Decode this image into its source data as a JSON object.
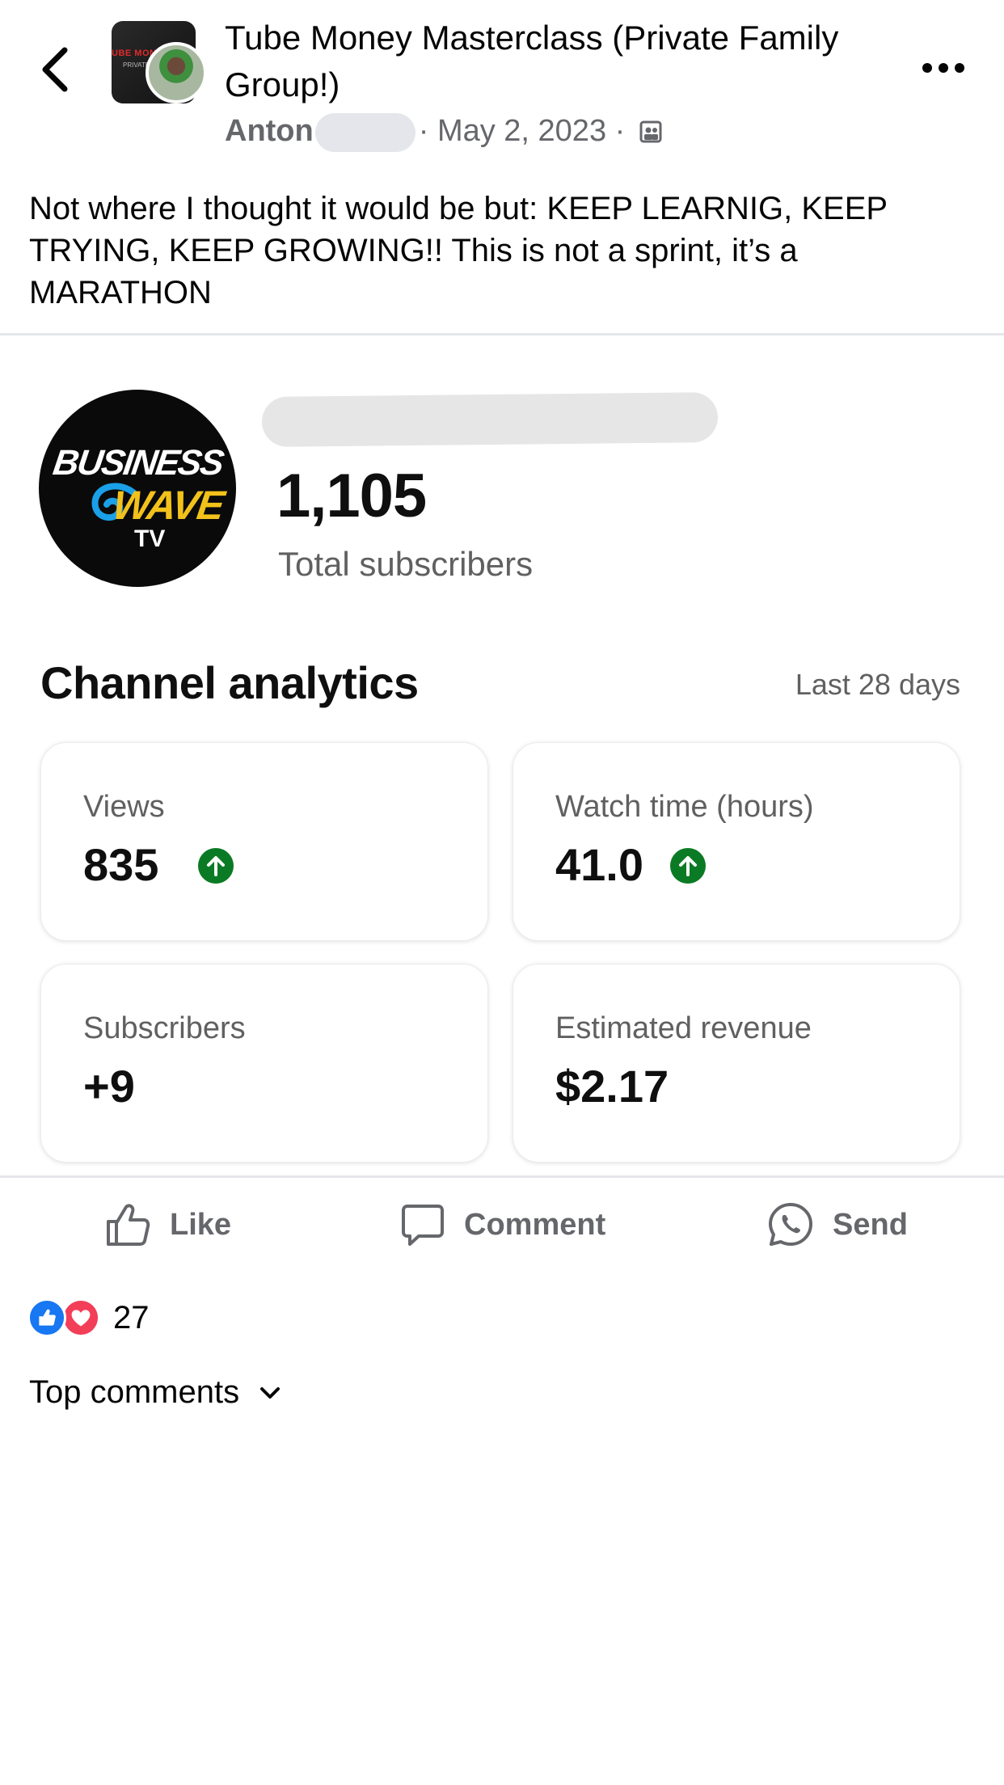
{
  "header": {
    "back_icon": "chevron-left-icon",
    "group_title": "Tube Money Masterclass (Private Family Group!)",
    "group_thumb_text_1": "UBE MONEY",
    "group_thumb_text_2": "PRIVATE F",
    "author": "Anton",
    "date": "· May 2, 2023 ·",
    "privacy_icon": "group-privacy-icon",
    "more_icon": "more-options-icon"
  },
  "post": {
    "text": "Not where I thought it would be but: KEEP LEARNIG, KEEP TRYING, KEEP GROWING!! This is not a sprint, it’s a MARATHON"
  },
  "screenshot": {
    "logo_text": [
      "BUSINESS",
      "WAVE",
      "TV"
    ],
    "subscriber_total": "1,105",
    "subscriber_label": "Total subscribers",
    "analytics_title": "Channel analytics",
    "period": "Last 28 days",
    "cards": [
      {
        "label": "Views",
        "value": "835",
        "trend": "up"
      },
      {
        "label": "Watch time (hours)",
        "value": "41.0",
        "trend": "up"
      },
      {
        "label": "Subscribers",
        "value": "+9",
        "trend": "none"
      },
      {
        "label": "Estimated revenue",
        "value": "$2.17",
        "trend": "none"
      }
    ],
    "trend_up_color": "#0b7a24"
  },
  "actions": {
    "like": "Like",
    "comment": "Comment",
    "send": "Send"
  },
  "reactions": {
    "count": "27",
    "types": [
      "like",
      "love"
    ]
  },
  "comments": {
    "label": "Top comments"
  }
}
